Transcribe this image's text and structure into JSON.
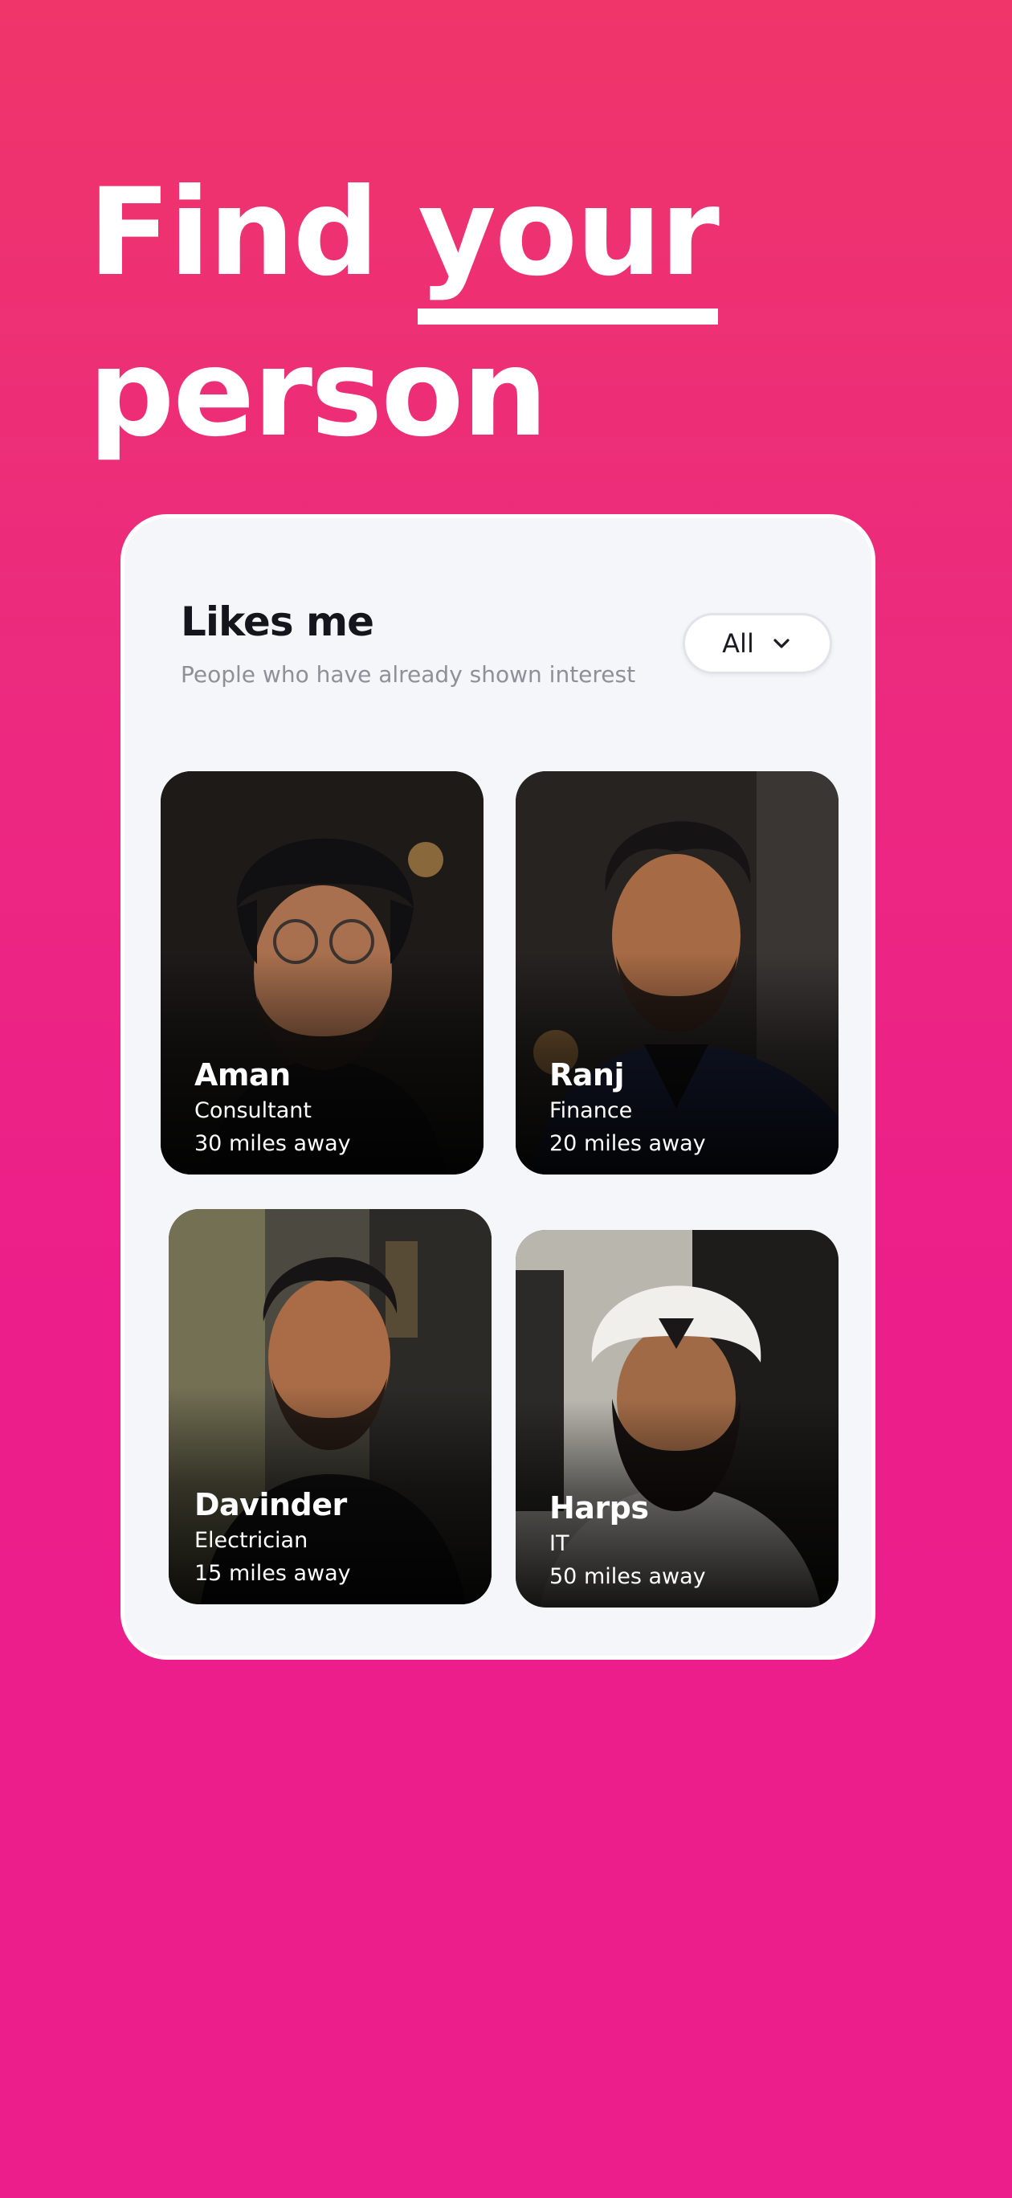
{
  "headline": {
    "word1": "Find",
    "word2": "your",
    "word3": "person"
  },
  "likes_panel": {
    "title": "Likes me",
    "subtitle": "People who have already shown interest",
    "filter": {
      "label": "All",
      "icon": "chevron-down-icon"
    }
  },
  "profiles": [
    {
      "name": "Aman",
      "job": "Consultant",
      "distance": "30 miles away"
    },
    {
      "name": "Ranj",
      "job": "Finance",
      "distance": "20 miles away"
    },
    {
      "name": "Davinder",
      "job": "Electrician",
      "distance": "15 miles away"
    },
    {
      "name": "Harps",
      "job": "IT",
      "distance": "50 miles away"
    }
  ],
  "colors": {
    "background_top": "#EF356A",
    "background_bottom": "#EC1E8C",
    "panel": "#F5F6FA",
    "text_dark": "#15151D",
    "text_muted": "#8F8F99"
  }
}
